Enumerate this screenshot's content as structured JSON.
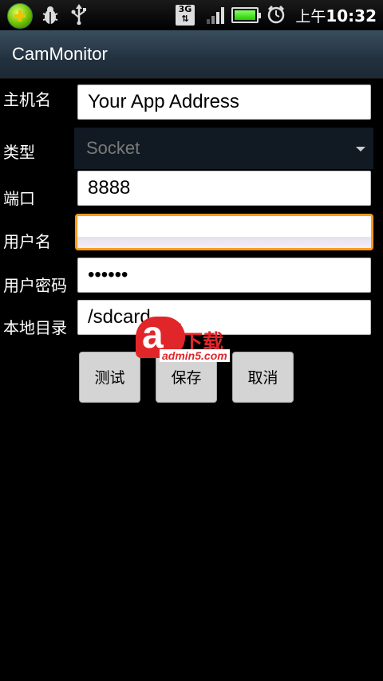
{
  "status_bar": {
    "icons": [
      "add-icon",
      "bug-icon",
      "usb-icon",
      "3g-icon",
      "signal-icon",
      "battery-icon",
      "alarm-icon"
    ],
    "network_label": "3G",
    "ampm": "上午",
    "time": "10:32",
    "battery_level_pct": 100
  },
  "app": {
    "title": "CamMonitor"
  },
  "form": {
    "host": {
      "label": "主机名",
      "value": "Your App Address"
    },
    "type": {
      "label": "类型",
      "value": "Socket"
    },
    "port": {
      "label": "端口",
      "value": "8888"
    },
    "username": {
      "label": "用户名",
      "value": ""
    },
    "password": {
      "label": "用户密码",
      "value": "••••••"
    },
    "local_dir": {
      "label": "本地目录",
      "value": "/sdcard"
    }
  },
  "buttons": {
    "test": "测试",
    "save": "保存",
    "cancel": "取消"
  },
  "watermark": {
    "brand": "a",
    "five": "5",
    "text": "下载",
    "domain": "admin5.com"
  },
  "colors": {
    "focus_border": "#ff9a1a",
    "watermark_red": "#e1262a",
    "titlebar": "#2a3a48"
  }
}
